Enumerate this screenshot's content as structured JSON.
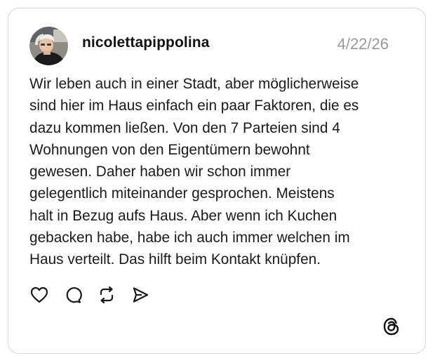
{
  "post": {
    "username": "nicolettapippolina",
    "date": "4/22/26",
    "text": "Wir leben auch in einer Stadt, aber möglicherweise\nsind hier im Haus einfach ein paar Faktoren, die es\ndazu kommen ließen. Von den 7 Parteien sind 4\nWohnungen von den Eigentümern bewohnt\ngewesen. Daher haben wir schon immer\ngelegentlich miteinander gesprochen. Meistens\nhalt in Bezug aufs Haus. Aber wenn ich Kuchen\ngebacken habe, habe ich auch immer welchen im\nHaus verteilt. Das hilft beim Kontakt knüpfen."
  },
  "actions": {
    "like_icon": "heart-icon",
    "reply_icon": "comment-icon",
    "repost_icon": "repost-icon",
    "share_icon": "send-icon"
  },
  "brand": {
    "logo_icon": "threads-logo-icon"
  },
  "colors": {
    "border": "#d9d9d9",
    "text": "#1a1a1a",
    "muted": "#9a9a9a"
  }
}
